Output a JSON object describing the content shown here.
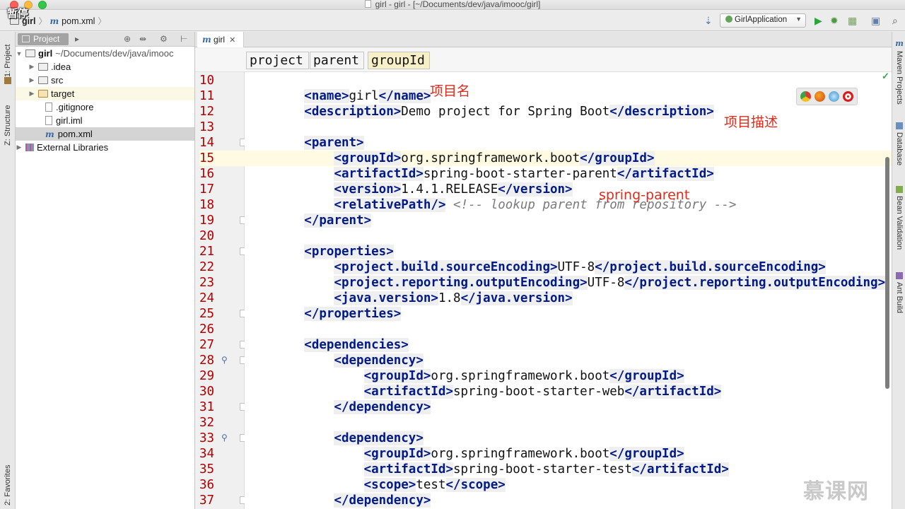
{
  "window": {
    "title": "girl - girl - [~/Documents/dev/java/imooc/girl]",
    "pause_overlay": "暂停"
  },
  "navbar": {
    "project_crumb": "girl",
    "file_crumb": "pom.xml",
    "run_config": "GirlApplication"
  },
  "left_strip": {
    "project_tab": "1: Project",
    "structure_tab": "Z: Structure",
    "favorites_tab": "2: Favorites"
  },
  "project_panel": {
    "tab_label": "Project",
    "tree": [
      {
        "label": "girl",
        "detail": "~/Documents/dev/java/imooc",
        "kind": "root"
      },
      {
        "label": ".idea",
        "kind": "folder"
      },
      {
        "label": "src",
        "kind": "folder"
      },
      {
        "label": "target",
        "kind": "folder"
      },
      {
        "label": ".gitignore",
        "kind": "file"
      },
      {
        "label": "girl.iml",
        "kind": "file"
      },
      {
        "label": "pom.xml",
        "kind": "maven"
      },
      {
        "label": "External Libraries",
        "kind": "libraries"
      }
    ]
  },
  "editor": {
    "tab_label": "girl",
    "tag_breadcrumb": [
      "project",
      "parent",
      "groupId"
    ],
    "lines": [
      {
        "n": "10",
        "indent": 0,
        "open": "",
        "text": "",
        "close": "",
        "comment": ""
      },
      {
        "n": "11",
        "indent": 1,
        "open": "<name>",
        "text": "girl",
        "close": "</name>",
        "comment": ""
      },
      {
        "n": "12",
        "indent": 1,
        "open": "<description>",
        "text": "Demo project for Spring Boot",
        "close": "</description>",
        "comment": ""
      },
      {
        "n": "13",
        "indent": 0,
        "open": "",
        "text": "",
        "close": "",
        "comment": ""
      },
      {
        "n": "14",
        "indent": 1,
        "open": "<parent>",
        "text": "",
        "close": "",
        "comment": ""
      },
      {
        "n": "15",
        "indent": 2,
        "open": "<groupId>",
        "text": "org.springframework.boot",
        "close": "</groupId>",
        "comment": ""
      },
      {
        "n": "16",
        "indent": 2,
        "open": "<artifactId>",
        "text": "spring-boot-starter-parent",
        "close": "</artifactId>",
        "comment": ""
      },
      {
        "n": "17",
        "indent": 2,
        "open": "<version>",
        "text": "1.4.1.RELEASE",
        "close": "</version>",
        "comment": ""
      },
      {
        "n": "18",
        "indent": 2,
        "open": "<relativePath/>",
        "text": " ",
        "close": "",
        "comment": "<!-- lookup parent from repository -->"
      },
      {
        "n": "19",
        "indent": 1,
        "open": "</parent>",
        "text": "",
        "close": "",
        "comment": ""
      },
      {
        "n": "20",
        "indent": 0,
        "open": "",
        "text": "",
        "close": "",
        "comment": ""
      },
      {
        "n": "21",
        "indent": 1,
        "open": "<properties>",
        "text": "",
        "close": "",
        "comment": ""
      },
      {
        "n": "22",
        "indent": 2,
        "open": "<project.build.sourceEncoding>",
        "text": "UTF-8",
        "close": "</project.build.sourceEncoding>",
        "comment": ""
      },
      {
        "n": "23",
        "indent": 2,
        "open": "<project.reporting.outputEncoding>",
        "text": "UTF-8",
        "close": "</project.reporting.outputEncoding>",
        "comment": ""
      },
      {
        "n": "24",
        "indent": 2,
        "open": "<java.version>",
        "text": "1.8",
        "close": "</java.version>",
        "comment": ""
      },
      {
        "n": "25",
        "indent": 1,
        "open": "</properties>",
        "text": "",
        "close": "",
        "comment": ""
      },
      {
        "n": "26",
        "indent": 0,
        "open": "",
        "text": "",
        "close": "",
        "comment": ""
      },
      {
        "n": "27",
        "indent": 1,
        "open": "<dependencies>",
        "text": "",
        "close": "",
        "comment": ""
      },
      {
        "n": "28",
        "indent": 2,
        "open": "<dependency>",
        "text": "",
        "close": "",
        "comment": ""
      },
      {
        "n": "29",
        "indent": 3,
        "open": "<groupId>",
        "text": "org.springframework.boot",
        "close": "</groupId>",
        "comment": ""
      },
      {
        "n": "30",
        "indent": 3,
        "open": "<artifactId>",
        "text": "spring-boot-starter-web",
        "close": "</artifactId>",
        "comment": ""
      },
      {
        "n": "31",
        "indent": 2,
        "open": "</dependency>",
        "text": "",
        "close": "",
        "comment": ""
      },
      {
        "n": "32",
        "indent": 0,
        "open": "",
        "text": "",
        "close": "",
        "comment": ""
      },
      {
        "n": "33",
        "indent": 2,
        "open": "<dependency>",
        "text": "",
        "close": "",
        "comment": ""
      },
      {
        "n": "34",
        "indent": 3,
        "open": "<groupId>",
        "text": "org.springframework.boot",
        "close": "</groupId>",
        "comment": ""
      },
      {
        "n": "35",
        "indent": 3,
        "open": "<artifactId>",
        "text": "spring-boot-starter-test",
        "close": "</artifactId>",
        "comment": ""
      },
      {
        "n": "36",
        "indent": 3,
        "open": "<scope>",
        "text": "test",
        "close": "</scope>",
        "comment": ""
      },
      {
        "n": "37",
        "indent": 2,
        "open": "</dependency>",
        "text": "",
        "close": "",
        "comment": ""
      }
    ],
    "highlighted_line": "15"
  },
  "annotations": {
    "name_note": "项目名",
    "description_note": "项目描述",
    "parent_note": "spring-parent"
  },
  "right_strip": {
    "maven_tab": "Maven Projects",
    "database_tab": "Database",
    "bean_tab": "Bean Validation",
    "ant_tab": "Ant Build"
  },
  "watermark": "慕课网",
  "colors": {
    "tag": "#001a8a",
    "line_number": "#b00000",
    "annotation": "#e02a1a",
    "highlight_line": "#fffbe3"
  }
}
